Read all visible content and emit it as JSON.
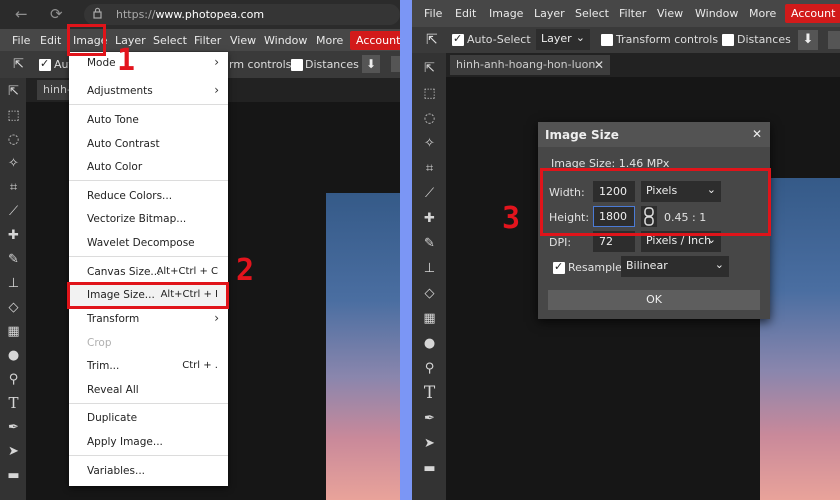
{
  "browser": {
    "url_prefix": "https://",
    "url_host": "www.photopea.com"
  },
  "menubar": {
    "items": [
      "File",
      "Edit",
      "Image",
      "Layer",
      "Select",
      "Filter",
      "View",
      "Window",
      "More"
    ],
    "account_label": "Account"
  },
  "left_options": {
    "auto_select_partial": "Aut",
    "transform_partial": "rm controls",
    "distances": "Distances"
  },
  "left_tab": {
    "label_partial": "hinh-a"
  },
  "image_menu": {
    "items": [
      {
        "label": "Mode",
        "shortcut": "",
        "submenu": true,
        "disabled": false
      },
      {
        "label": "Adjustments",
        "shortcut": "",
        "submenu": true,
        "disabled": false
      },
      {
        "label": "Auto Tone",
        "shortcut": "",
        "submenu": false,
        "disabled": false
      },
      {
        "label": "Auto Contrast",
        "shortcut": "",
        "submenu": false,
        "disabled": false
      },
      {
        "label": "Auto Color",
        "shortcut": "",
        "submenu": false,
        "disabled": false
      },
      {
        "label": "Reduce Colors...",
        "shortcut": "",
        "submenu": false,
        "disabled": false
      },
      {
        "label": "Vectorize Bitmap...",
        "shortcut": "",
        "submenu": false,
        "disabled": false
      },
      {
        "label": "Wavelet Decompose",
        "shortcut": "",
        "submenu": false,
        "disabled": false
      },
      {
        "label": "Canvas Size...",
        "shortcut": "Alt+Ctrl + C",
        "submenu": false,
        "disabled": false
      },
      {
        "label": "Image Size...",
        "shortcut": "Alt+Ctrl + I",
        "submenu": false,
        "disabled": false
      },
      {
        "label": "Transform",
        "shortcut": "",
        "submenu": true,
        "disabled": false
      },
      {
        "label": "Crop",
        "shortcut": "",
        "submenu": false,
        "disabled": true
      },
      {
        "label": "Trim...",
        "shortcut": "Ctrl + .",
        "submenu": false,
        "disabled": false
      },
      {
        "label": "Reveal All",
        "shortcut": "",
        "submenu": false,
        "disabled": false
      },
      {
        "label": "Duplicate",
        "shortcut": "",
        "submenu": false,
        "disabled": false
      },
      {
        "label": "Apply Image...",
        "shortcut": "",
        "submenu": false,
        "disabled": false
      },
      {
        "label": "Variables...",
        "shortcut": "",
        "submenu": false,
        "disabled": false
      }
    ]
  },
  "steps": {
    "one": "1",
    "two": "2",
    "three": "3"
  },
  "right_options": {
    "auto_select": "Auto-Select",
    "layer_select": "Layer",
    "transform_controls": "Transform controls",
    "distances": "Distances"
  },
  "right_tab": {
    "label": "hinh-anh-hoang-hon-luon"
  },
  "image_size_dialog": {
    "title": "Image Size",
    "info": "Image Size: 1.46 MPx",
    "width_label": "Width:",
    "width_value": "1200",
    "width_unit": "Pixels",
    "height_label": "Height:",
    "height_value": "1800",
    "ratio": "0.45 : 1",
    "dpi_label": "DPI:",
    "dpi_value": "72",
    "dpi_unit": "Pixels / Inch",
    "resample_label": "Resample",
    "resample_checked": true,
    "resample_method": "Bilinear",
    "ok_label": "OK"
  },
  "colors": {
    "accent_red": "#d21a1a",
    "highlight_red": "#e0141a",
    "divider_blue": "#7b96f5",
    "menubar": "#474747"
  }
}
